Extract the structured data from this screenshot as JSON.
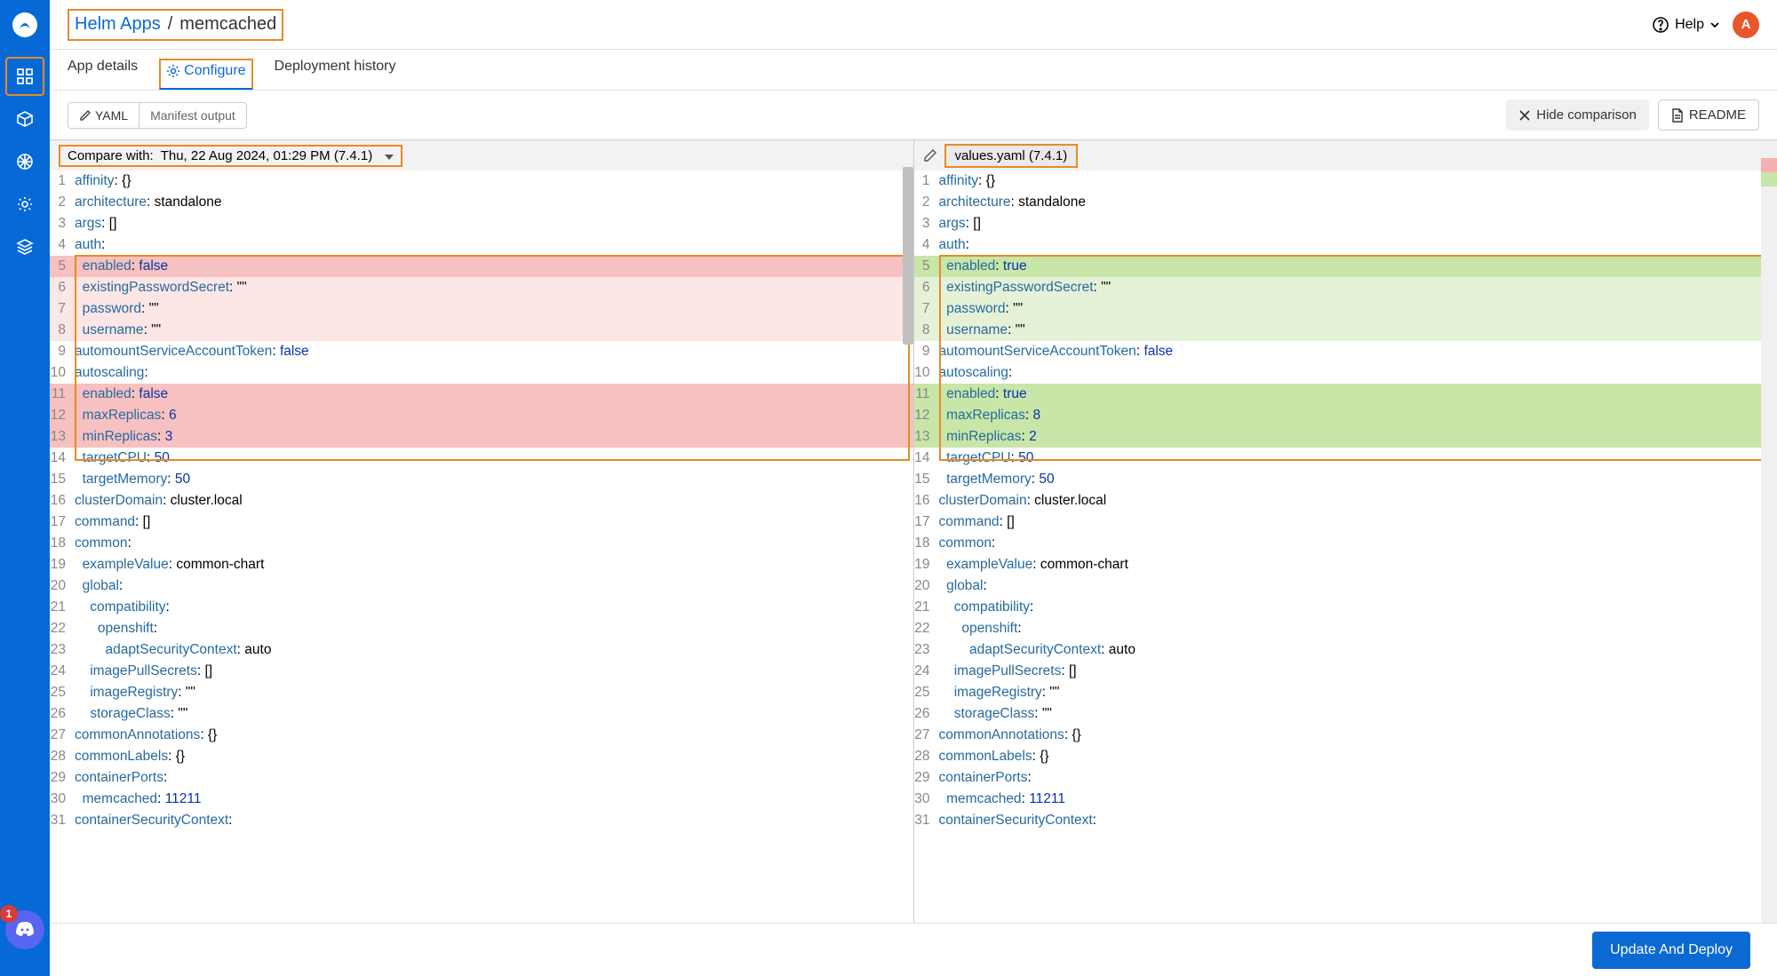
{
  "header": {
    "breadcrumb_root": "Helm Apps",
    "breadcrumb_sep": " / ",
    "breadcrumb_current": "memcached",
    "help": "Help",
    "avatar_letter": "A"
  },
  "tabs": {
    "app_details": "App details",
    "configure": "Configure",
    "deployment_history": "Deployment history"
  },
  "toolbar": {
    "yaml": "YAML",
    "manifest": "Manifest output",
    "hide_comparison": "Hide comparison",
    "readme": "README"
  },
  "compare": {
    "label": "Compare with:",
    "value": "Thu, 22 Aug 2024, 01:29 PM (7.4.1)"
  },
  "right_file": "values.yaml (7.4.1)",
  "footer": {
    "update_deploy": "Update And Deploy"
  },
  "discord_count": "1",
  "left_lines": [
    {
      "n": 1,
      "t": "<k>affinity</k>: {}"
    },
    {
      "n": 2,
      "t": "<k>architecture</k>: standalone"
    },
    {
      "n": 3,
      "t": "<k>args</k>: []"
    },
    {
      "n": 4,
      "t": "<k>auth</k>:"
    },
    {
      "n": 5,
      "cls": "line-removed",
      "t": "  <k>enabled</k>: <b>false</b>"
    },
    {
      "n": 6,
      "cls": "line-removed-soft",
      "t": "  <k>existingPasswordSecret</k>: \"\""
    },
    {
      "n": 7,
      "cls": "line-removed-soft",
      "t": "  <k>password</k>: \"\""
    },
    {
      "n": 8,
      "cls": "line-removed-soft",
      "t": "  <k>username</k>: \"\""
    },
    {
      "n": 9,
      "t": "<k>automountServiceAccountToken</k>: <b>false</b>"
    },
    {
      "n": 10,
      "t": "<k>autoscaling</k>:"
    },
    {
      "n": 11,
      "cls": "line-removed",
      "t": "  <k>enabled</k>: <b>false</b>"
    },
    {
      "n": 12,
      "cls": "line-removed",
      "t": "  <k>maxReplicas</k>: <n>6</n>"
    },
    {
      "n": 13,
      "cls": "line-removed",
      "t": "  <k>minReplicas</k>: <n>3</n>"
    },
    {
      "n": 14,
      "t": "  <k>targetCPU</k>: <n>50</n>"
    },
    {
      "n": 15,
      "t": "  <k>targetMemory</k>: <n>50</n>"
    },
    {
      "n": 16,
      "t": "<k>clusterDomain</k>: cluster.local"
    },
    {
      "n": 17,
      "t": "<k>command</k>: []"
    },
    {
      "n": 18,
      "t": "<k>common</k>:"
    },
    {
      "n": 19,
      "t": "  <k>exampleValue</k>: common-chart"
    },
    {
      "n": 20,
      "t": "  <k>global</k>:"
    },
    {
      "n": 21,
      "t": "    <k>compatibility</k>:"
    },
    {
      "n": 22,
      "t": "      <k>openshift</k>:"
    },
    {
      "n": 23,
      "t": "        <k>adaptSecurityContext</k>: auto"
    },
    {
      "n": 24,
      "t": "    <k>imagePullSecrets</k>: []"
    },
    {
      "n": 25,
      "t": "    <k>imageRegistry</k>: \"\""
    },
    {
      "n": 26,
      "t": "    <k>storageClass</k>: \"\""
    },
    {
      "n": 27,
      "t": "<k>commonAnnotations</k>: {}"
    },
    {
      "n": 28,
      "t": "<k>commonLabels</k>: {}"
    },
    {
      "n": 29,
      "t": "<k>containerPorts</k>:"
    },
    {
      "n": 30,
      "t": "  <k>memcached</k>: <n>11211</n>"
    },
    {
      "n": 31,
      "t": "<k>containerSecurityContext</k>:"
    }
  ],
  "right_lines": [
    {
      "n": 1,
      "t": "<k>affinity</k>: {}"
    },
    {
      "n": 2,
      "t": "<k>architecture</k>: standalone"
    },
    {
      "n": 3,
      "t": "<k>args</k>: []"
    },
    {
      "n": 4,
      "t": "<k>auth</k>:"
    },
    {
      "n": 5,
      "cls": "line-added",
      "t": "  <k>enabled</k>: <b>true</b>"
    },
    {
      "n": 6,
      "cls": "line-added-soft",
      "t": "  <k>existingPasswordSecret</k>: \"\""
    },
    {
      "n": 7,
      "cls": "line-added-soft",
      "t": "  <k>password</k>: \"\""
    },
    {
      "n": 8,
      "cls": "line-added-soft",
      "t": "  <k>username</k>: \"\""
    },
    {
      "n": 9,
      "t": "<k>automountServiceAccountToken</k>: <b>false</b>"
    },
    {
      "n": 10,
      "t": "<k>autoscaling</k>:"
    },
    {
      "n": 11,
      "cls": "line-added",
      "t": "  <k>enabled</k>: <b>true</b>"
    },
    {
      "n": 12,
      "cls": "line-added",
      "t": "  <k>maxReplicas</k>: <n>8</n>"
    },
    {
      "n": 13,
      "cls": "line-added",
      "t": "  <k>minReplicas</k>: <n>2</n>"
    },
    {
      "n": 14,
      "t": "  <k>targetCPU</k>: <n>50</n>"
    },
    {
      "n": 15,
      "t": "  <k>targetMemory</k>: <n>50</n>"
    },
    {
      "n": 16,
      "t": "<k>clusterDomain</k>: cluster.local"
    },
    {
      "n": 17,
      "t": "<k>command</k>: []"
    },
    {
      "n": 18,
      "t": "<k>common</k>:"
    },
    {
      "n": 19,
      "t": "  <k>exampleValue</k>: common-chart"
    },
    {
      "n": 20,
      "t": "  <k>global</k>:"
    },
    {
      "n": 21,
      "t": "    <k>compatibility</k>:"
    },
    {
      "n": 22,
      "t": "      <k>openshift</k>:"
    },
    {
      "n": 23,
      "t": "        <k>adaptSecurityContext</k>: auto"
    },
    {
      "n": 24,
      "t": "    <k>imagePullSecrets</k>: []"
    },
    {
      "n": 25,
      "t": "    <k>imageRegistry</k>: \"\""
    },
    {
      "n": 26,
      "t": "    <k>storageClass</k>: \"\""
    },
    {
      "n": 27,
      "t": "<k>commonAnnotations</k>: {}"
    },
    {
      "n": 28,
      "t": "<k>commonLabels</k>: {}"
    },
    {
      "n": 29,
      "t": "<k>containerPorts</k>:"
    },
    {
      "n": 30,
      "t": "  <k>memcached</k>: <n>11211</n>"
    },
    {
      "n": 31,
      "t": "<k>containerSecurityContext</k>:"
    }
  ]
}
